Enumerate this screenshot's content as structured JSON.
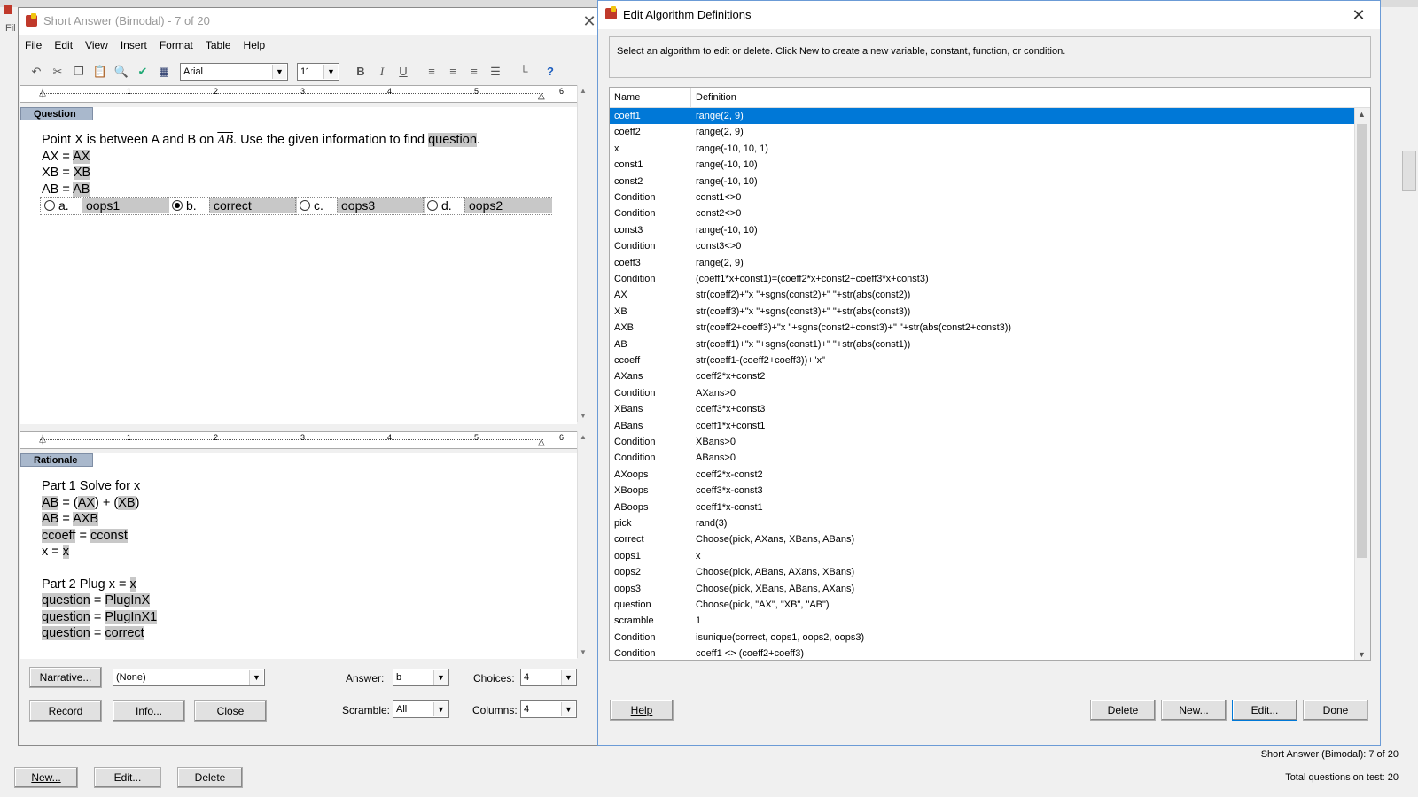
{
  "main_window": {
    "title": "Short Answer (Bimodal) - 7 of 20",
    "menus": [
      "File",
      "Edit",
      "View",
      "Insert",
      "Format",
      "Table",
      "Help"
    ],
    "font_name": "Arial",
    "font_size": "11",
    "ruler_numbers": [
      "1",
      "2",
      "3",
      "4",
      "5",
      "6"
    ],
    "question_label": "Question",
    "rationale_label": "Rationale",
    "question": {
      "line1_pre": "Point X is between A and B on ",
      "line1_seg": "AB",
      "line1_mid": ".  Use the given information to find ",
      "line1_var": "question",
      "line1_end": ".",
      "lines": [
        {
          "pre": "AX = ",
          "var": "AX"
        },
        {
          "pre": "XB = ",
          "var": "XB"
        },
        {
          "pre": "AB = ",
          "var": "AB"
        }
      ],
      "choices": [
        {
          "letter": "a.",
          "value": "oops1",
          "selected": false
        },
        {
          "letter": "b.",
          "value": "correct",
          "selected": true
        },
        {
          "letter": "c.",
          "value": "oops3",
          "selected": false
        },
        {
          "letter": "d.",
          "value": "oops2",
          "selected": false
        }
      ]
    },
    "rationale": {
      "part1": "Part 1 Solve for x",
      "r1a": "AB",
      "r1b": " = (",
      "r1c": "AX",
      "r1d": ") + (",
      "r1e": "XB",
      "r1f": ")",
      "r2a": "AB",
      "r2b": " = ",
      "r2c": "AXB",
      "r3a": "ccoeff",
      "r3b": " = ",
      "r3c": "cconst",
      "r4a": "x = ",
      "r4b": "x",
      "part2a": "Part 2 Plug x = ",
      "part2b": "x",
      "q1a": "question",
      "q1b": " = ",
      "q1c": "PlugInX",
      "q2a": "question",
      "q2b": " = ",
      "q2c": "PlugInX1",
      "q3a": "question",
      "q3b": " = ",
      "q3c": "correct"
    },
    "bottom": {
      "narrative_btn": "Narrative...",
      "narrative_value": "(None)",
      "answer_label": "Answer:",
      "answer_value": "b",
      "choices_label": "Choices:",
      "choices_value": "4",
      "record_btn": "Record",
      "info_btn": "Info...",
      "close_btn": "Close",
      "scramble_label": "Scramble:",
      "scramble_value": "All",
      "columns_label": "Columns:",
      "columns_value": "4"
    }
  },
  "algo_dialog": {
    "title": "Edit Algorithm Definitions",
    "instructions": "Select an algorithm to edit or delete. Click New to create a new variable, constant, function, or condition.",
    "col_name": "Name",
    "col_definition": "Definition",
    "rows": [
      {
        "name": "coeff1",
        "def": "range(2, 9)"
      },
      {
        "name": "coeff2",
        "def": "range(2, 9)"
      },
      {
        "name": "x",
        "def": "range(-10, 10, 1)"
      },
      {
        "name": "const1",
        "def": "range(-10, 10)"
      },
      {
        "name": "const2",
        "def": "range(-10, 10)"
      },
      {
        "name": "Condition",
        "def": "const1<>0"
      },
      {
        "name": "Condition",
        "def": "const2<>0"
      },
      {
        "name": "const3",
        "def": "range(-10, 10)"
      },
      {
        "name": "Condition",
        "def": "const3<>0"
      },
      {
        "name": "coeff3",
        "def": "range(2, 9)"
      },
      {
        "name": "Condition",
        "def": "(coeff1*x+const1)=(coeff2*x+const2+coeff3*x+const3)"
      },
      {
        "name": "AX",
        "def": "str(coeff2)+\"x \"+sgns(const2)+\" \"+str(abs(const2))"
      },
      {
        "name": "XB",
        "def": "str(coeff3)+\"x \"+sgns(const3)+\" \"+str(abs(const3))"
      },
      {
        "name": "AXB",
        "def": "str(coeff2+coeff3)+\"x \"+sgns(const2+const3)+\" \"+str(abs(const2+const3))"
      },
      {
        "name": "AB",
        "def": "str(coeff1)+\"x \"+sgns(const1)+\" \"+str(abs(const1))"
      },
      {
        "name": "ccoeff",
        "def": "str(coeff1-(coeff2+coeff3))+\"x\""
      },
      {
        "name": "AXans",
        "def": "coeff2*x+const2"
      },
      {
        "name": "Condition",
        "def": "AXans>0"
      },
      {
        "name": "XBans",
        "def": "coeff3*x+const3"
      },
      {
        "name": "ABans",
        "def": "coeff1*x+const1"
      },
      {
        "name": "Condition",
        "def": "XBans>0"
      },
      {
        "name": "Condition",
        "def": "ABans>0"
      },
      {
        "name": "AXoops",
        "def": "coeff2*x-const2"
      },
      {
        "name": "XBoops",
        "def": "coeff3*x-const3"
      },
      {
        "name": "ABoops",
        "def": "coeff1*x-const1"
      },
      {
        "name": "pick",
        "def": "rand(3)"
      },
      {
        "name": "correct",
        "def": "Choose(pick, AXans, XBans, ABans)"
      },
      {
        "name": "oops1",
        "def": "x"
      },
      {
        "name": "oops2",
        "def": "Choose(pick, ABans, AXans, XBans)"
      },
      {
        "name": "oops3",
        "def": "Choose(pick, XBans, ABans, AXans)"
      },
      {
        "name": "question",
        "def": "Choose(pick, \"AX\", \"XB\", \"AB\")"
      },
      {
        "name": "scramble",
        "def": "1"
      },
      {
        "name": "Condition",
        "def": "isunique(correct, oops1, oops2, oops3)"
      },
      {
        "name": "Condition",
        "def": "coeff1 <> (coeff2+coeff3)"
      }
    ],
    "help_btn": "Help",
    "delete_btn": "Delete",
    "new_btn": "New...",
    "edit_btn": "Edit...",
    "done_btn": "Done"
  },
  "background": {
    "menu_fragment": "Fil",
    "new_btn": "New...",
    "edit_btn": "Edit...",
    "delete_btn": "Delete",
    "status1": "Short Answer (Bimodal): 7 of 20",
    "status2": "Total questions on test:  20"
  }
}
